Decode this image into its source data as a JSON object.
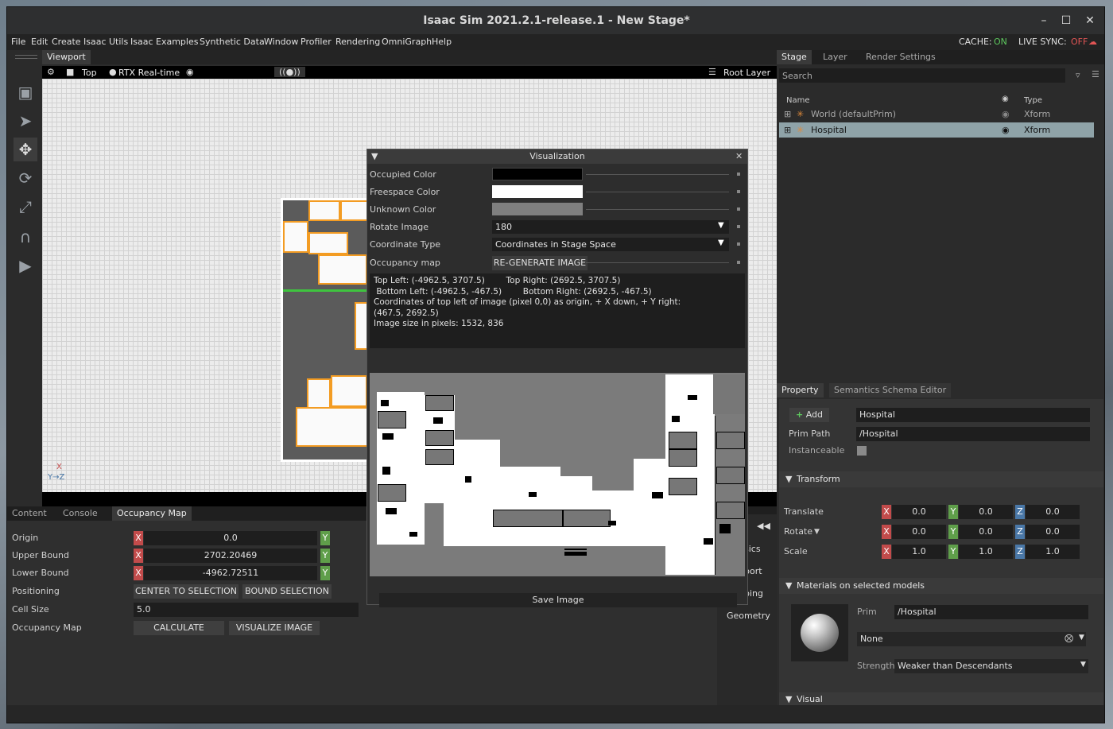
{
  "window": {
    "title": "Isaac Sim 2021.2.1-release.1 - New Stage*"
  },
  "menus": [
    "File",
    "Edit",
    "Create",
    "Isaac Utils",
    "Isaac Examples",
    "Synthetic Data",
    "Window",
    "Profiler",
    "Rendering",
    "OmniGraph",
    "Help"
  ],
  "indicators": {
    "cache_label": "CACHE:",
    "cache_value": "ON",
    "live_label": "LIVE SYNC:",
    "live_value": "OFF"
  },
  "colors": {
    "accent_green": "#5ec85e",
    "accent_red": "#e25555",
    "room_orange": "#f39c23",
    "x_axis": "#c24b4b",
    "y_axis": "#5f9e4a",
    "z_axis": "#4a78a8"
  },
  "viewport": {
    "tab": "Viewport",
    "camera": "Top",
    "render_mode": "RTX Real-time",
    "layer": "Root Layer",
    "axis_x": "X",
    "axis_yz": "Y→Z"
  },
  "bottom_tabs": [
    "Content",
    "Console",
    "Occupancy Map"
  ],
  "occupancy": {
    "origin_label": "Origin",
    "origin_x": "0.0",
    "upper_label": "Upper Bound",
    "upper_x": "2702.20469",
    "lower_label": "Lower Bound",
    "lower_x": "-4962.72511",
    "positioning_label": "Positioning",
    "center_btn": "CENTER TO SELECTION",
    "bound_btn": "BOUND SELECTION",
    "cell_label": "Cell Size",
    "cell_value": "5.0",
    "map_label": "Occupancy Map",
    "calc_btn": "CALCULATE",
    "visualize_btn": "VISUALIZE IMAGE",
    "axis_x": "X",
    "axis_y": "Y"
  },
  "side_panel_items": [
    "sics",
    "port",
    "ping",
    "Geometry"
  ],
  "visualization": {
    "title": "Visualization",
    "occupied_label": "Occupied Color",
    "freespace_label": "Freespace Color",
    "unknown_label": "Unknown Color",
    "rotate_label": "Rotate Image",
    "rotate_value": "180",
    "coord_label": "Coordinate Type",
    "coord_value": "Coordinates in Stage Space",
    "occmap_label": "Occupancy map",
    "regen_btn": "RE-GENERATE IMAGE",
    "info_line1": "Top Left: (-4962.5, 3707.5)        Top Right: (2692.5, 3707.5)",
    "info_line2": " Bottom Left: (-4962.5, -467.5)        Bottom Right: (2692.5, -467.5)",
    "info_line3": "Coordinates of top left of image (pixel 0,0) as origin, + X down, + Y right:",
    "info_line4": "(467.5, 2692.5)",
    "info_line5": "Image size in pixels: 1532, 836",
    "save_btn": "Save Image",
    "occupied_color": "#000000",
    "freespace_color": "#ffffff",
    "unknown_color": "#7f7f7f"
  },
  "stage": {
    "tabs": [
      "Stage",
      "Layer",
      "Render Settings"
    ],
    "search_placeholder": "Search",
    "col_name": "Name",
    "col_type": "Type",
    "rows": [
      {
        "name": "World (defaultPrim)",
        "type": "Xform"
      },
      {
        "name": "Hospital",
        "type": "Xform"
      }
    ]
  },
  "property": {
    "tabs": [
      "Property",
      "Semantics Schema Editor"
    ],
    "add_btn": "Add",
    "name_value": "Hospital",
    "prim_path_label": "Prim Path",
    "prim_path_value": "/Hospital",
    "instanceable_label": "Instanceable",
    "transform_header": "Transform",
    "translate_label": "Translate",
    "rotate_label": "Rotate",
    "scale_label": "Scale",
    "translate": [
      "0.0",
      "0.0",
      "0.0"
    ],
    "rotate": [
      "0.0",
      "0.0",
      "0.0"
    ],
    "scale": [
      "1.0",
      "1.0",
      "1.0"
    ],
    "axis_x": "X",
    "axis_y": "Y",
    "axis_z": "Z",
    "materials_header": "Materials on selected models",
    "prim_label": "Prim",
    "prim_value": "/Hospital",
    "material_value": "None",
    "strength_label": "Strength",
    "strength_value": "Weaker than Descendants",
    "visual_header": "Visual"
  }
}
